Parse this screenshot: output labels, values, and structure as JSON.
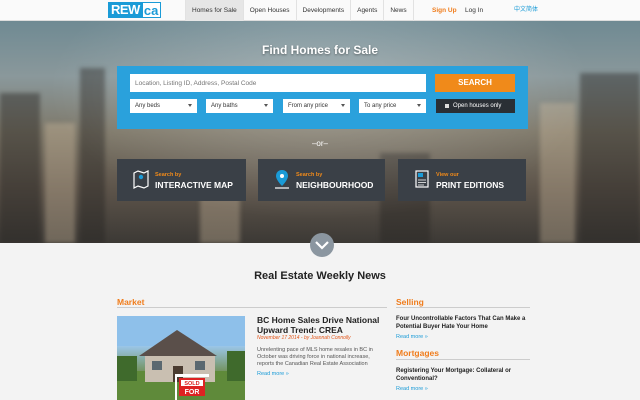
{
  "nav": {
    "logo_left": "REW",
    "logo_right": "ca",
    "items": [
      {
        "label": "Homes for Sale",
        "active": true
      },
      {
        "label": "Open Houses",
        "active": false
      },
      {
        "label": "Developments",
        "active": false
      },
      {
        "label": "Agents",
        "active": false
      },
      {
        "label": "News",
        "active": false
      }
    ],
    "signup": "Sign Up",
    "login": "Log In",
    "language": "中文简体"
  },
  "hero": {
    "title": "Find Homes for Sale",
    "search_placeholder": "Location, Listing ID, Address, Postal Code",
    "search_button": "SEARCH",
    "filters": {
      "beds": "Any beds",
      "baths": "Any baths",
      "min_price": "From any price",
      "max_price": "To any price"
    },
    "open_houses": "Open houses only",
    "or_text": "–or–",
    "tiles": [
      {
        "small": "Search by",
        "big": "INTERACTIVE MAP",
        "icon": "map-icon"
      },
      {
        "small": "Search by",
        "big": "NEIGHBOURHOOD",
        "icon": "location-pin-icon"
      },
      {
        "small": "View our",
        "big": "PRINT EDITIONS",
        "icon": "newspaper-icon"
      }
    ]
  },
  "news": {
    "title": "Real Estate Weekly News",
    "market": {
      "label": "Market",
      "article_title": "BC Home Sales Drive National Upward Trend: CREA",
      "date": "November 17 2014 - by Joannah Connolly",
      "body": "Unrelenting pace of MLS home resales in BC in October was driving force in national increase, reports the Canadian Real Estate Association",
      "read_more": "Read more »",
      "sign_text_1": "FOR",
      "sign_text_2": "SOLD"
    },
    "selling": {
      "label": "Selling",
      "title": "Four Uncontrollable Factors That Can Make a Potential Buyer Hate Your Home",
      "read_more": "Read more »"
    },
    "mortgages": {
      "label": "Mortgages",
      "title": "Registering Your Mortgage: Collateral or Conventional?",
      "read_more": "Read more »"
    }
  },
  "colors": {
    "brand_blue": "#1a9bd7",
    "accent_orange": "#f08a1a",
    "panel_blue": "#2aa1dc",
    "tile_dark": "#3a4047"
  }
}
